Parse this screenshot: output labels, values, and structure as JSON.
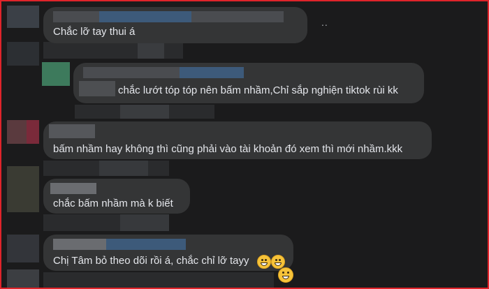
{
  "comments": [
    {
      "text": "Chắc lỡ tay thui á"
    },
    {
      "text": "chắc lướt tóp tóp nên bấm nhầm,Chỉ sắp nghiện tiktok rùi kk"
    },
    {
      "text": "bấm nhầm hay không thì cũng phải vào tài khoản đó xem thì mới nhầm.kkk"
    },
    {
      "text": "chắc bấm nhầm mà k biết"
    },
    {
      "text": "Chị Tâm bỏ theo dõi rồi á, chắc chỉ lỡ tayy"
    }
  ],
  "more_indicator": "..",
  "icons": {
    "emoji": "grinning-face-emoji",
    "more": "more-options-icon"
  },
  "colors": {
    "border": "#e0242a",
    "background": "#1b1b1c",
    "bubble": "#343536",
    "text": "#e4e6eb"
  }
}
